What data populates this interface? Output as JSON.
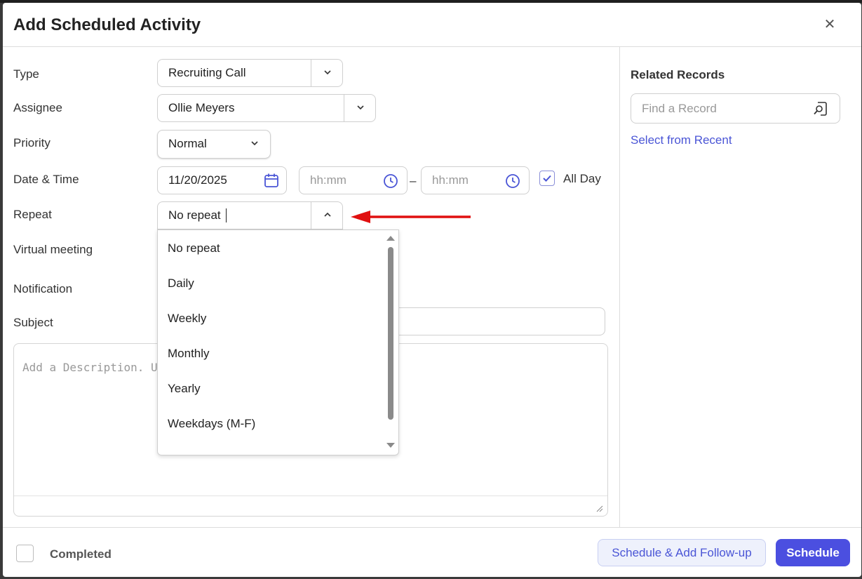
{
  "modal": {
    "title": "Add Scheduled Activity",
    "close_icon": "close-icon"
  },
  "form": {
    "type": {
      "label": "Type",
      "value": "Recruiting Call"
    },
    "assignee": {
      "label": "Assignee",
      "value": "Ollie Meyers"
    },
    "priority": {
      "label": "Priority",
      "value": "Normal"
    },
    "datetime": {
      "label": "Date & Time",
      "date": "11/20/2025",
      "start_placeholder": "hh:mm",
      "separator": "–",
      "end_placeholder": "hh:mm",
      "all_day_label": "All Day",
      "all_day_checked": true
    },
    "repeat": {
      "label": "Repeat",
      "value": "No repeat",
      "options": [
        "No repeat",
        "Daily",
        "Weekly",
        "Monthly",
        "Yearly",
        "Weekdays (M-F)"
      ]
    },
    "virtual_meeting": {
      "label": "Virtual meeting"
    },
    "notification": {
      "label": "Notification"
    },
    "subject": {
      "label": "Subject"
    },
    "description": {
      "placeholder": "Add a Description. Us"
    }
  },
  "related": {
    "heading": "Related Records",
    "search_placeholder": "Find a Record",
    "select_recent": "Select from Recent"
  },
  "footer": {
    "completed_label": "Completed",
    "follow_up_button": "Schedule & Add Follow-up",
    "schedule_button": "Schedule"
  },
  "colors": {
    "accent": "#4a55d6",
    "primary_button": "#4b4fe0",
    "annotation_arrow": "#e01010"
  }
}
